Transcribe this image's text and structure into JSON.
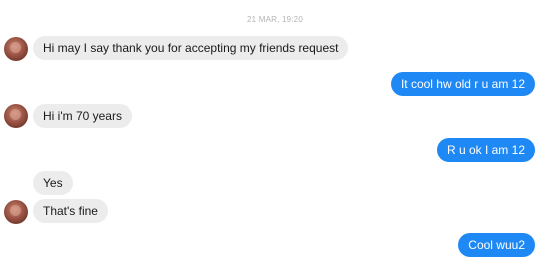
{
  "chat": {
    "timestamp": "21 MAR, 19:20",
    "messages": [
      {
        "direction": "incoming",
        "text": "Hi may I say thank you for accepting my friends request"
      },
      {
        "direction": "outgoing",
        "text": "It cool hw old r u  am 12"
      },
      {
        "direction": "incoming",
        "text": "Hi i'm 70 years"
      },
      {
        "direction": "outgoing",
        "text": "R u ok I am 12"
      },
      {
        "direction": "incoming",
        "text": "Yes"
      },
      {
        "direction": "incoming",
        "text": "That's fine"
      },
      {
        "direction": "outgoing",
        "text": "Cool wuu2"
      }
    ]
  },
  "colors": {
    "incoming_bubble": "#ececec",
    "outgoing_bubble": "#1e88f5",
    "timestamp_text": "#b4b4b4"
  },
  "icons": {
    "avatar": "contact-avatar"
  }
}
